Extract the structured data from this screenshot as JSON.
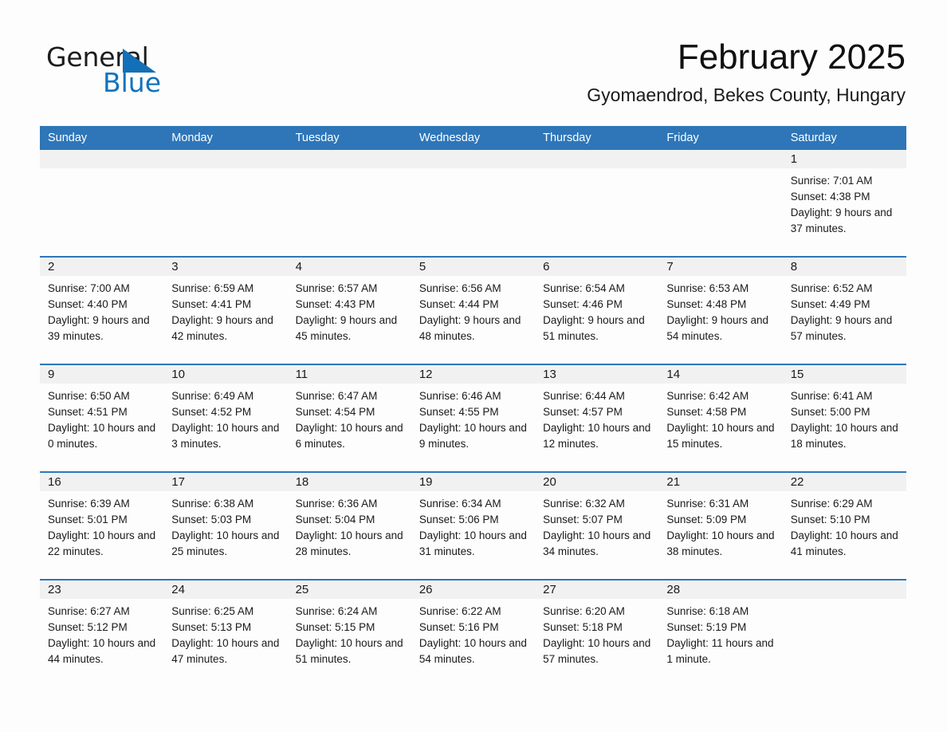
{
  "brand": {
    "name_part1": "General",
    "name_part2": "Blue",
    "logo_icon": "triangle-flag-icon",
    "accent_color": "#1273bd"
  },
  "header": {
    "month_title": "February 2025",
    "location": "Gyomaendrod, Bekes County, Hungary"
  },
  "calendar": {
    "header_color": "#2e76b8",
    "day_band_color": "#f1f1f1",
    "weekdays": [
      "Sunday",
      "Monday",
      "Tuesday",
      "Wednesday",
      "Thursday",
      "Friday",
      "Saturday"
    ],
    "weeks": [
      [
        {
          "day": "",
          "sunrise": "",
          "sunset": "",
          "daylight": ""
        },
        {
          "day": "",
          "sunrise": "",
          "sunset": "",
          "daylight": ""
        },
        {
          "day": "",
          "sunrise": "",
          "sunset": "",
          "daylight": ""
        },
        {
          "day": "",
          "sunrise": "",
          "sunset": "",
          "daylight": ""
        },
        {
          "day": "",
          "sunrise": "",
          "sunset": "",
          "daylight": ""
        },
        {
          "day": "",
          "sunrise": "",
          "sunset": "",
          "daylight": ""
        },
        {
          "day": "1",
          "sunrise": "Sunrise: 7:01 AM",
          "sunset": "Sunset: 4:38 PM",
          "daylight": "Daylight: 9 hours and 37 minutes."
        }
      ],
      [
        {
          "day": "2",
          "sunrise": "Sunrise: 7:00 AM",
          "sunset": "Sunset: 4:40 PM",
          "daylight": "Daylight: 9 hours and 39 minutes."
        },
        {
          "day": "3",
          "sunrise": "Sunrise: 6:59 AM",
          "sunset": "Sunset: 4:41 PM",
          "daylight": "Daylight: 9 hours and 42 minutes."
        },
        {
          "day": "4",
          "sunrise": "Sunrise: 6:57 AM",
          "sunset": "Sunset: 4:43 PM",
          "daylight": "Daylight: 9 hours and 45 minutes."
        },
        {
          "day": "5",
          "sunrise": "Sunrise: 6:56 AM",
          "sunset": "Sunset: 4:44 PM",
          "daylight": "Daylight: 9 hours and 48 minutes."
        },
        {
          "day": "6",
          "sunrise": "Sunrise: 6:54 AM",
          "sunset": "Sunset: 4:46 PM",
          "daylight": "Daylight: 9 hours and 51 minutes."
        },
        {
          "day": "7",
          "sunrise": "Sunrise: 6:53 AM",
          "sunset": "Sunset: 4:48 PM",
          "daylight": "Daylight: 9 hours and 54 minutes."
        },
        {
          "day": "8",
          "sunrise": "Sunrise: 6:52 AM",
          "sunset": "Sunset: 4:49 PM",
          "daylight": "Daylight: 9 hours and 57 minutes."
        }
      ],
      [
        {
          "day": "9",
          "sunrise": "Sunrise: 6:50 AM",
          "sunset": "Sunset: 4:51 PM",
          "daylight": "Daylight: 10 hours and 0 minutes."
        },
        {
          "day": "10",
          "sunrise": "Sunrise: 6:49 AM",
          "sunset": "Sunset: 4:52 PM",
          "daylight": "Daylight: 10 hours and 3 minutes."
        },
        {
          "day": "11",
          "sunrise": "Sunrise: 6:47 AM",
          "sunset": "Sunset: 4:54 PM",
          "daylight": "Daylight: 10 hours and 6 minutes."
        },
        {
          "day": "12",
          "sunrise": "Sunrise: 6:46 AM",
          "sunset": "Sunset: 4:55 PM",
          "daylight": "Daylight: 10 hours and 9 minutes."
        },
        {
          "day": "13",
          "sunrise": "Sunrise: 6:44 AM",
          "sunset": "Sunset: 4:57 PM",
          "daylight": "Daylight: 10 hours and 12 minutes."
        },
        {
          "day": "14",
          "sunrise": "Sunrise: 6:42 AM",
          "sunset": "Sunset: 4:58 PM",
          "daylight": "Daylight: 10 hours and 15 minutes."
        },
        {
          "day": "15",
          "sunrise": "Sunrise: 6:41 AM",
          "sunset": "Sunset: 5:00 PM",
          "daylight": "Daylight: 10 hours and 18 minutes."
        }
      ],
      [
        {
          "day": "16",
          "sunrise": "Sunrise: 6:39 AM",
          "sunset": "Sunset: 5:01 PM",
          "daylight": "Daylight: 10 hours and 22 minutes."
        },
        {
          "day": "17",
          "sunrise": "Sunrise: 6:38 AM",
          "sunset": "Sunset: 5:03 PM",
          "daylight": "Daylight: 10 hours and 25 minutes."
        },
        {
          "day": "18",
          "sunrise": "Sunrise: 6:36 AM",
          "sunset": "Sunset: 5:04 PM",
          "daylight": "Daylight: 10 hours and 28 minutes."
        },
        {
          "day": "19",
          "sunrise": "Sunrise: 6:34 AM",
          "sunset": "Sunset: 5:06 PM",
          "daylight": "Daylight: 10 hours and 31 minutes."
        },
        {
          "day": "20",
          "sunrise": "Sunrise: 6:32 AM",
          "sunset": "Sunset: 5:07 PM",
          "daylight": "Daylight: 10 hours and 34 minutes."
        },
        {
          "day": "21",
          "sunrise": "Sunrise: 6:31 AM",
          "sunset": "Sunset: 5:09 PM",
          "daylight": "Daylight: 10 hours and 38 minutes."
        },
        {
          "day": "22",
          "sunrise": "Sunrise: 6:29 AM",
          "sunset": "Sunset: 5:10 PM",
          "daylight": "Daylight: 10 hours and 41 minutes."
        }
      ],
      [
        {
          "day": "23",
          "sunrise": "Sunrise: 6:27 AM",
          "sunset": "Sunset: 5:12 PM",
          "daylight": "Daylight: 10 hours and 44 minutes."
        },
        {
          "day": "24",
          "sunrise": "Sunrise: 6:25 AM",
          "sunset": "Sunset: 5:13 PM",
          "daylight": "Daylight: 10 hours and 47 minutes."
        },
        {
          "day": "25",
          "sunrise": "Sunrise: 6:24 AM",
          "sunset": "Sunset: 5:15 PM",
          "daylight": "Daylight: 10 hours and 51 minutes."
        },
        {
          "day": "26",
          "sunrise": "Sunrise: 6:22 AM",
          "sunset": "Sunset: 5:16 PM",
          "daylight": "Daylight: 10 hours and 54 minutes."
        },
        {
          "day": "27",
          "sunrise": "Sunrise: 6:20 AM",
          "sunset": "Sunset: 5:18 PM",
          "daylight": "Daylight: 10 hours and 57 minutes."
        },
        {
          "day": "28",
          "sunrise": "Sunrise: 6:18 AM",
          "sunset": "Sunset: 5:19 PM",
          "daylight": "Daylight: 11 hours and 1 minute."
        },
        {
          "day": "",
          "sunrise": "",
          "sunset": "",
          "daylight": ""
        }
      ]
    ]
  }
}
